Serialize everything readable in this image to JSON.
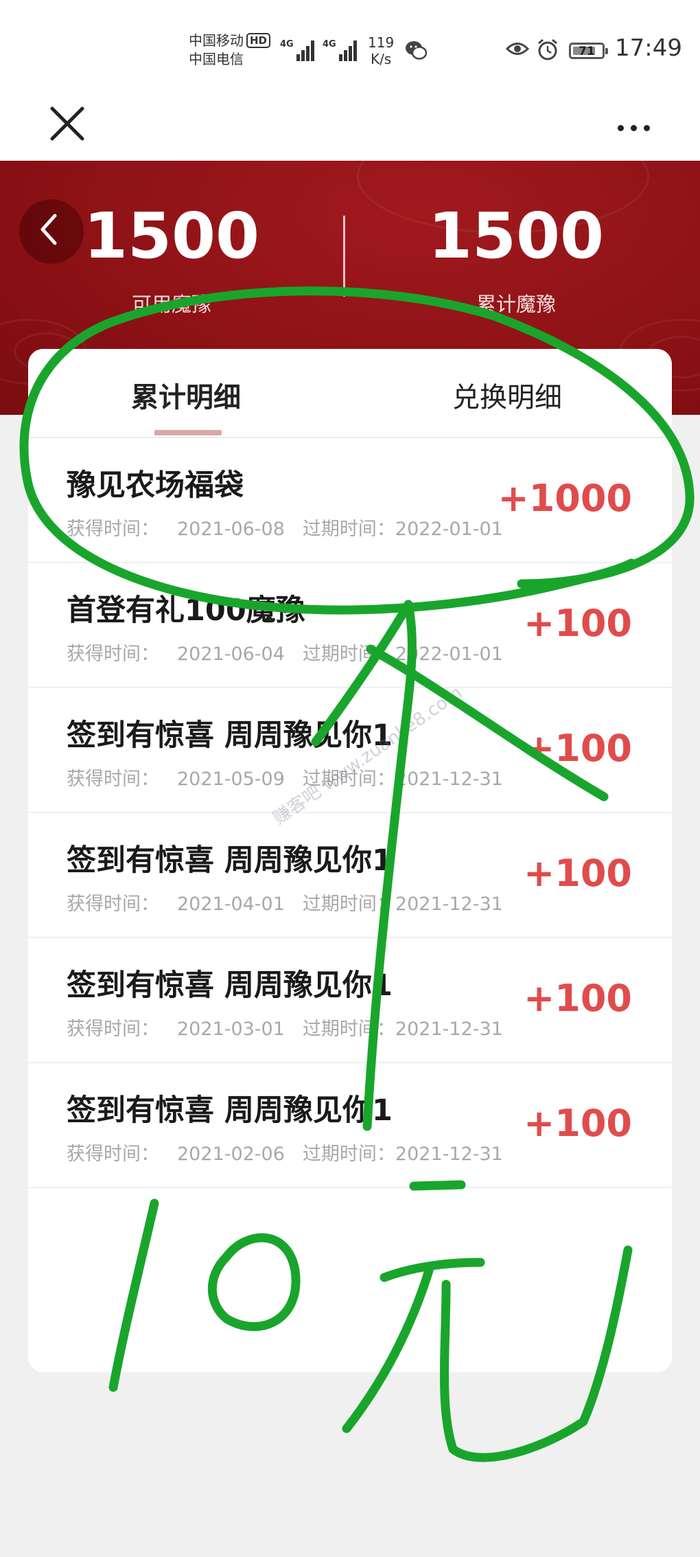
{
  "status_bar": {
    "carrier1": "中国移动",
    "hd": "HD",
    "carrier2": "中国电信",
    "net1": "4G",
    "net2": "4G",
    "speed_value": "119",
    "speed_unit": "K/s",
    "battery": "71",
    "time": "17:49"
  },
  "header": {
    "available_value": "1500",
    "available_label": "可用魔豫",
    "total_value": "1500",
    "total_label": "累计魔豫"
  },
  "tabs": [
    {
      "label": "累计明细",
      "active": true
    },
    {
      "label": "兑换明细",
      "active": false
    }
  ],
  "meta_labels": {
    "obtained": "获得时间：",
    "expires": "过期时间："
  },
  "records": [
    {
      "title": "豫见农场福袋",
      "obtained": "2021-06-08",
      "expires": "2022-01-01",
      "amount": "+1000"
    },
    {
      "title": "首登有礼100魔豫",
      "obtained": "2021-06-04",
      "expires": "2022-01-01",
      "amount": "+100"
    },
    {
      "title": "签到有惊喜 周周豫见你1",
      "obtained": "2021-05-09",
      "expires": "2021-12-31",
      "amount": "+100"
    },
    {
      "title": "签到有惊喜 周周豫见你1",
      "obtained": "2021-04-01",
      "expires": "2021-12-31",
      "amount": "+100"
    },
    {
      "title": "签到有惊喜 周周豫见你1",
      "obtained": "2021-03-01",
      "expires": "2021-12-31",
      "amount": "+100"
    },
    {
      "title": "签到有惊喜 周周豫见你1",
      "obtained": "2021-02-06",
      "expires": "2021-12-31",
      "amount": "+100"
    }
  ],
  "watermark": "赚客吧 www.zuanke8.com",
  "annotation": {
    "color": "#19a52c",
    "handwritten_text": "10元"
  },
  "colors": {
    "hero": "#8e1216",
    "amount": "#e04c4c",
    "tab_indicator": "#d9a7a7"
  },
  "icons": [
    "close-icon",
    "more-icon",
    "back-icon",
    "wechat-icon",
    "eye-icon",
    "alarm-icon",
    "battery-icon",
    "signal-icon"
  ]
}
